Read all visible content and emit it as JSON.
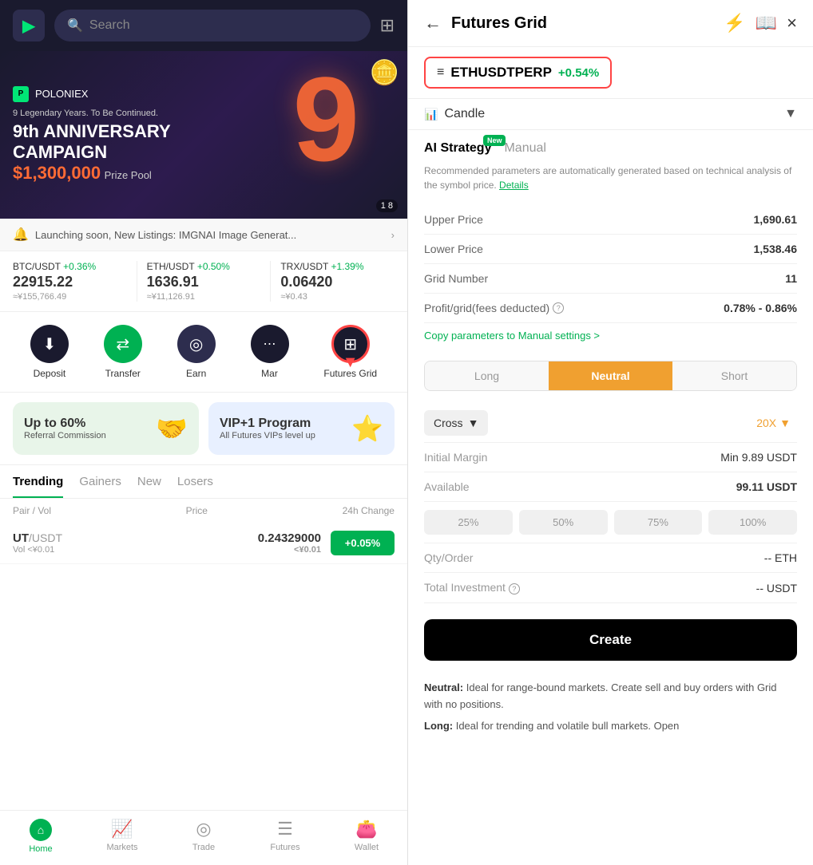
{
  "left": {
    "header": {
      "search_placeholder": "Search",
      "logo_text": "▶"
    },
    "banner": {
      "logo_name": "POLONIEX",
      "subtitle": "9 Legendary Years. To Be Continued.",
      "title_line1": "9th ANNIVERSARY",
      "title_line2": "CAMPAIGN",
      "prize": "$1,300,000",
      "prize_label": "Prize Pool",
      "big_number": "9",
      "pagination": "1 8"
    },
    "announcement": {
      "text": "Launching soon, New Listings: IMGNAI Image Generat...",
      "arrow": ">"
    },
    "tickers": [
      {
        "pair": "BTC/USDT",
        "change": "+0.36%",
        "price": "22915.22",
        "cny": "≈¥155,766.49"
      },
      {
        "pair": "ETH/USDT",
        "change": "+0.50%",
        "price": "1636.91",
        "cny": "≈¥11,126.91"
      },
      {
        "pair": "TRX/USDT",
        "change": "+1.39%",
        "price": "0.06420",
        "cny": "≈¥0.43"
      }
    ],
    "actions": [
      {
        "label": "Deposit",
        "icon": "⬇",
        "type": "dark"
      },
      {
        "label": "Transfer",
        "icon": "⇄",
        "type": "green-bg"
      },
      {
        "label": "Earn",
        "icon": "◎",
        "type": "dark2"
      },
      {
        "label": "Mar",
        "icon": "⋯",
        "type": "dark"
      },
      {
        "label": "Futures Grid",
        "icon": "⊞",
        "type": "futures-grid"
      }
    ],
    "promos": [
      {
        "title": "Up to 60%",
        "subtitle": "Referral Commission",
        "icon": "🤝"
      },
      {
        "title": "VIP+1 Program",
        "subtitle": "All Futures VIPs level up",
        "icon": "⭐"
      }
    ],
    "market_tabs": [
      "Trending",
      "Gainers",
      "New",
      "Losers"
    ],
    "market_header": {
      "pair_label": "Pair / Vol",
      "price_label": "Price",
      "change_label": "24h Change"
    },
    "market_rows": [
      {
        "base": "UT",
        "quote": "/USDT",
        "vol": "Vol <¥0.01",
        "price": "0.24329000",
        "price_sub": "<¥0.01",
        "change": "+0.05%"
      }
    ],
    "bottom_nav": [
      {
        "label": "Home",
        "icon": "⌂",
        "active": true
      },
      {
        "label": "Markets",
        "icon": "📈"
      },
      {
        "label": "Trade",
        "icon": "◎"
      },
      {
        "label": "Futures",
        "icon": "☰"
      },
      {
        "label": "Wallet",
        "icon": "👛"
      }
    ]
  },
  "right": {
    "header": {
      "back_label": "←",
      "title": "Futures Grid",
      "close_label": "×"
    },
    "symbol": {
      "name": "ETHUSDTPERP",
      "change": "+0.54%"
    },
    "candle": {
      "label": "Candle"
    },
    "strategy": {
      "ai_label": "AI Strategy",
      "manual_label": "Manual",
      "new_badge": "New",
      "desc1": "Recommended parameters are automatically generated based on",
      "desc2": "technical analysis of the symbol price.",
      "details_label": "Details"
    },
    "params": [
      {
        "label": "Upper Price",
        "value": "1,690.61"
      },
      {
        "label": "Lower Price",
        "value": "1,538.46"
      },
      {
        "label": "Grid Number",
        "value": "11"
      },
      {
        "label": "Profit/grid(fees deducted)",
        "value": "0.78% - 0.86%",
        "has_info": true
      }
    ],
    "copy_params": "Copy parameters to Manual settings >",
    "position_tabs": [
      "Long",
      "Neutral",
      "Short"
    ],
    "active_position": "Neutral",
    "margin": {
      "type": "Cross",
      "leverage": "20X"
    },
    "initial_margin": {
      "label": "Initial Margin",
      "value": "Min 9.89",
      "currency": "USDT"
    },
    "available": {
      "label": "Available",
      "value": "99.11 USDT"
    },
    "pct_buttons": [
      "25%",
      "50%",
      "75%",
      "100%"
    ],
    "qty_order": {
      "label": "Qty/Order",
      "value": "-- ETH"
    },
    "total_investment": {
      "label": "Total Investment",
      "value": "-- USDT",
      "has_info": true
    },
    "create_btn": "Create",
    "descriptions": [
      {
        "bold": "Neutral:",
        "text": " Ideal for range-bound markets. Create sell and buy orders with Grid with no positions."
      },
      {
        "bold": "Long:",
        "text": " Ideal for trending and volatile bull markets. Open"
      }
    ]
  }
}
